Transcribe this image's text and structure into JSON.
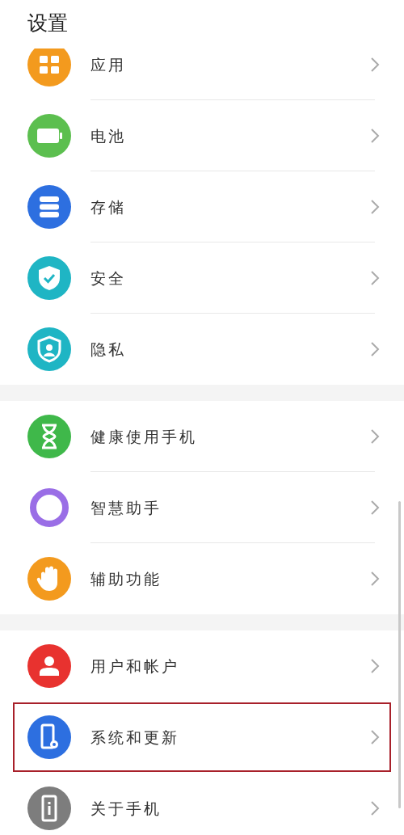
{
  "header": {
    "title": "设置"
  },
  "groups": [
    {
      "items": [
        {
          "label": "应用",
          "highlighted": false,
          "color": "#f39a1e"
        },
        {
          "label": "电池",
          "highlighted": false,
          "color": "#5cbf4f"
        },
        {
          "label": "存储",
          "highlighted": false,
          "color": "#2d6fe0"
        },
        {
          "label": "安全",
          "highlighted": false,
          "color": "#1fb5c4"
        },
        {
          "label": "隐私",
          "highlighted": false,
          "color": "#1fb5c4"
        }
      ]
    },
    {
      "items": [
        {
          "label": "健康使用手机",
          "highlighted": false,
          "color": "#3fb84a"
        },
        {
          "label": "智慧助手",
          "highlighted": false,
          "color": "#9a6ee6"
        },
        {
          "label": "辅助功能",
          "highlighted": false,
          "color": "#f39a1e"
        }
      ]
    },
    {
      "items": [
        {
          "label": "用户和帐户",
          "highlighted": false,
          "color": "#e8322f"
        },
        {
          "label": "系统和更新",
          "highlighted": true,
          "color": "#2d6fe0"
        },
        {
          "label": "关于手机",
          "highlighted": false,
          "color": "#7d7d7d"
        }
      ]
    }
  ]
}
